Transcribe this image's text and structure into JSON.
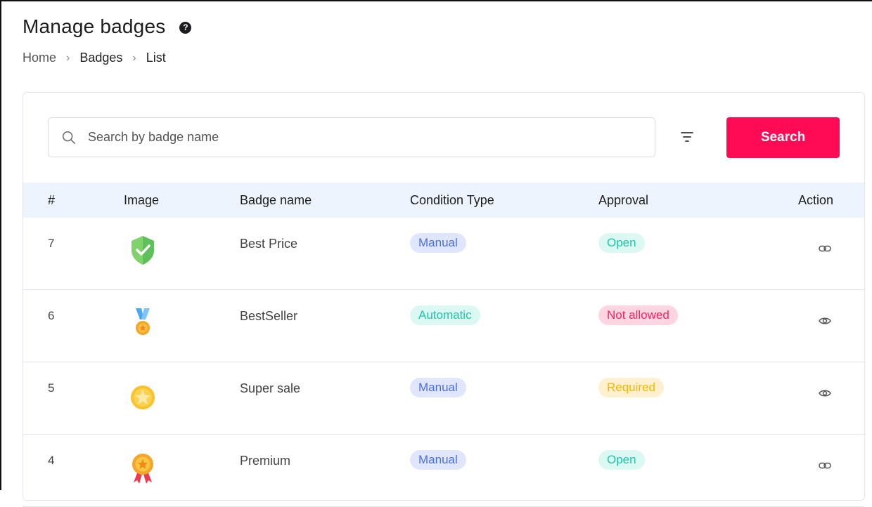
{
  "header": {
    "title": "Manage badges",
    "help_icon": "question-circle-icon"
  },
  "breadcrumb": [
    "Home",
    "Badges",
    "List"
  ],
  "search": {
    "placeholder": "Search by badge name",
    "value": "",
    "button_label": "Search",
    "filter_icon": "filter-lines-icon"
  },
  "table": {
    "columns": [
      "#",
      "Image",
      "Badge name",
      "Condition Type",
      "Approval",
      "Action"
    ],
    "rows": [
      {
        "num": "7",
        "image": "green-shield-check-icon",
        "name": "Best Price",
        "condition": "Manual",
        "approval": "Open",
        "action_icon": "link-icon"
      },
      {
        "num": "6",
        "image": "blue-ribbon-medal-icon",
        "name": "BestSeller",
        "condition": "Automatic",
        "approval": "Not allowed",
        "action_icon": "eye-icon"
      },
      {
        "num": "5",
        "image": "yellow-star-circle-icon",
        "name": "Super sale",
        "condition": "Manual",
        "approval": "Required",
        "action_icon": "eye-icon"
      },
      {
        "num": "4",
        "image": "gold-rosette-award-icon",
        "name": "Premium",
        "condition": "Manual",
        "approval": "Open",
        "action_icon": "link-icon"
      }
    ]
  },
  "colors": {
    "accent": "#ff0a54",
    "header_bg": "#eef4fd",
    "manual_pill": "#dfe6fd",
    "open_pill": "#dcf8f3",
    "not_allowed_pill": "#ffd5e2",
    "required_pill": "#fff1cf"
  }
}
